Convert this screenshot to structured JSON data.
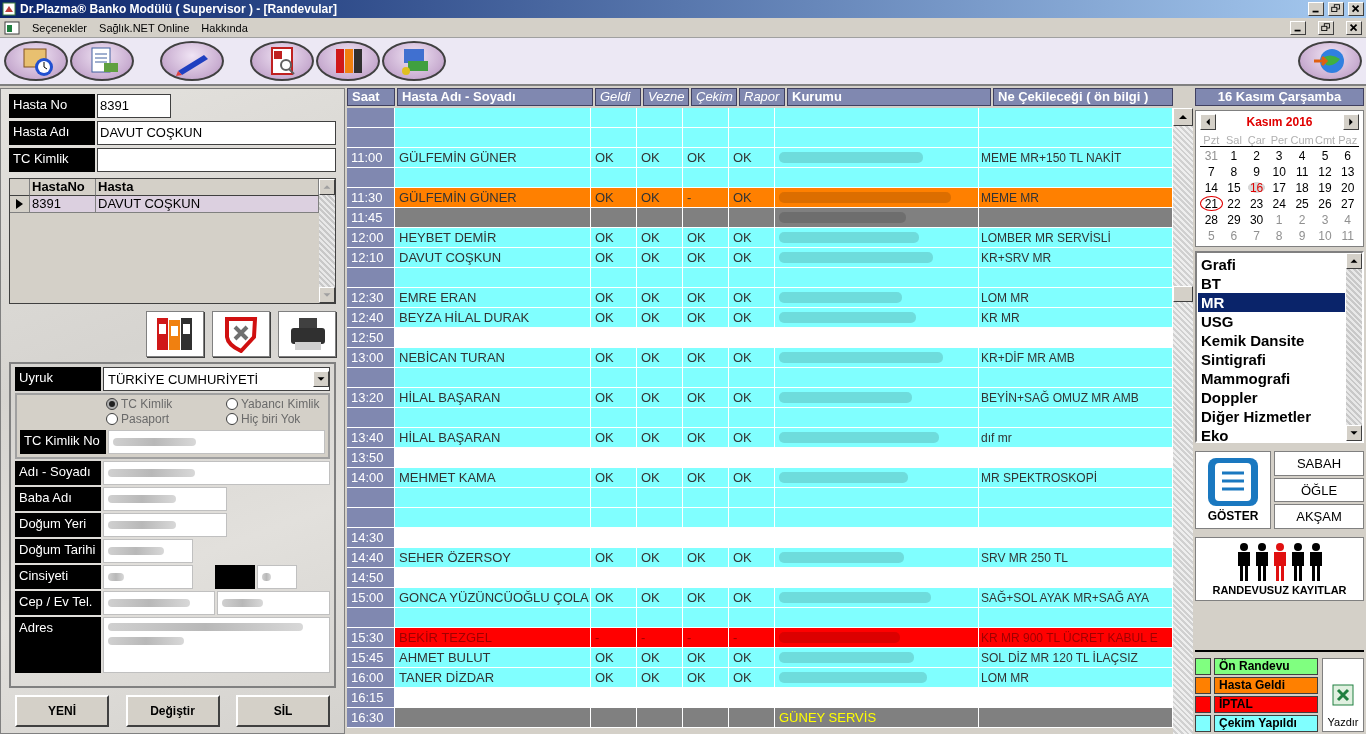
{
  "window": {
    "title": "Dr.Plazma® Banko Modülü ( Supervisor ) - [Randevular]"
  },
  "menu": [
    "Seçenekler",
    "Sağlık.NET Online",
    "Hakkında"
  ],
  "search_fields": [
    {
      "label": "Hasta No",
      "value": "8391",
      "kind": "short"
    },
    {
      "label": "Hasta Adı",
      "value": "DAVUT COŞKUN",
      "kind": "long"
    },
    {
      "label": "TC Kimlik",
      "kind": "long"
    }
  ],
  "patients": {
    "columns": [
      "HastaNo",
      "Hasta"
    ],
    "rows": [
      {
        "cells": [
          "8391",
          "DAVUT COŞKUN"
        ],
        "selected": true
      }
    ]
  },
  "nationality": {
    "label": "Uyruk",
    "value": "TÜRKİYE CUMHURİYETİ"
  },
  "radios": {
    "disabled": true,
    "options": [
      {
        "label": "TC Kimlik",
        "selected": true
      },
      {
        "label": "Yabancı Kimlik",
        "selected": false
      },
      {
        "label": "Pasaport",
        "selected": false
      },
      {
        "label": "Hiç biri Yok",
        "selected": false
      }
    ]
  },
  "form": [
    {
      "label": "TC Kimlik No",
      "kind": "long",
      "redacted": true
    },
    {
      "label": "Adı - Soyadı",
      "kind": "long",
      "redacted": true
    },
    {
      "label": "Baba Adı",
      "kind": "medium",
      "redacted": true
    },
    {
      "label": "Doğum Yeri",
      "kind": "medium",
      "redacted": true
    },
    {
      "label": "Doğum Tarihi",
      "kind": "short",
      "redacted": true
    },
    {
      "label": "Cinsiyeti",
      "kind": "select",
      "redacted": true
    },
    {
      "label": "Cep / Ev Tel.",
      "kind": "phone",
      "redacted": true
    },
    {
      "label": "Adres",
      "kind": "address",
      "redacted": true
    }
  ],
  "actions": [
    "YENİ",
    "Değiştir",
    "SİL"
  ],
  "schedule": {
    "columns": [
      {
        "label": "Saat",
        "italic": false
      },
      {
        "label": "Hasta Adı - Soyadı",
        "italic": false
      },
      {
        "label": "Geldi",
        "italic": true
      },
      {
        "label": "Vezne",
        "italic": true
      },
      {
        "label": "Çekim",
        "italic": true
      },
      {
        "label": "Rapor",
        "italic": true
      },
      {
        "label": "Kurumu",
        "italic": false
      },
      {
        "label": "Ne Çekileceği ( ön bilgi )",
        "italic": false
      }
    ],
    "rows": [
      {
        "color": "#80ffff",
        "kurum_redacted": false
      },
      {
        "color": "#80ffff",
        "kurum_redacted": false
      },
      {
        "time": "11:00",
        "name": "GÜLFEMİN GÜNER",
        "checks": [
          "OK",
          "OK",
          "OK",
          "OK"
        ],
        "kurum_redacted": true,
        "detail": "MEME MR+150 TL NAKİT",
        "color": "#80ffff"
      },
      {
        "color": "#80ffff",
        "kurum_redacted": false
      },
      {
        "time": "11:30",
        "name": "GÜLFEMİN GÜNER",
        "checks": [
          "OK",
          "OK",
          "-",
          "OK"
        ],
        "kurum_redacted": true,
        "detail": "MEME MR",
        "color": "#ff8000"
      },
      {
        "time": "11:45",
        "kurum_redacted": true,
        "color": "#808080"
      },
      {
        "time": "12:00",
        "name": "HEYBET DEMİR",
        "checks": [
          "OK",
          "OK",
          "OK",
          "OK"
        ],
        "kurum_redacted": true,
        "detail": "LOMBER MR SERVİSLİ",
        "color": "#80ffff"
      },
      {
        "time": "12:10",
        "name": "DAVUT COŞKUN",
        "checks": [
          "OK",
          "OK",
          "OK",
          "OK"
        ],
        "kurum_redacted": true,
        "detail": "KR+SRV MR",
        "color": "#80ffff"
      },
      {
        "color": "#80ffff",
        "kurum_redacted": false
      },
      {
        "time": "12:30",
        "name": "EMRE ERAN",
        "checks": [
          "OK",
          "OK",
          "OK",
          "OK"
        ],
        "kurum_redacted": true,
        "detail": "LOM MR",
        "color": "#80ffff"
      },
      {
        "time": "12:40",
        "name": "BEYZA HİLAL DURAK",
        "checks": [
          "OK",
          "OK",
          "OK",
          "OK"
        ],
        "kurum_redacted": true,
        "detail": "KR MR",
        "color": "#80ffff"
      },
      {
        "time": "12:50",
        "color": "#ffffff",
        "kurum_redacted": false
      },
      {
        "time": "13:00",
        "name": "NEBİCAN TURAN",
        "checks": [
          "OK",
          "OK",
          "OK",
          "OK"
        ],
        "kurum_redacted": true,
        "detail": "KR+DİF MR AMB",
        "color": "#80ffff"
      },
      {
        "color": "#80ffff",
        "kurum_redacted": false
      },
      {
        "time": "13:20",
        "name": "HİLAL BAŞARAN",
        "checks": [
          "OK",
          "OK",
          "OK",
          "OK"
        ],
        "kurum_redacted": true,
        "detail": "BEYİN+SAĞ OMUZ MR AMB",
        "color": "#80ffff"
      },
      {
        "color": "#80ffff",
        "kurum_redacted": false
      },
      {
        "time": "13:40",
        "name": "HİLAL BAŞARAN",
        "checks": [
          "OK",
          "OK",
          "OK",
          "OK"
        ],
        "kurum_redacted": true,
        "detail": "dıf mr",
        "color": "#80ffff"
      },
      {
        "time": "13:50",
        "color": "#ffffff",
        "kurum_redacted": false
      },
      {
        "time": "14:00",
        "name": "MEHMET KAMA",
        "checks": [
          "OK",
          "OK",
          "OK",
          "OK"
        ],
        "kurum_redacted": true,
        "detail": "MR SPEKTROSKOPİ",
        "color": "#80ffff"
      },
      {
        "color": "#80ffff",
        "kurum_redacted": false
      },
      {
        "color": "#80ffff",
        "kurum_redacted": false
      },
      {
        "time": "14:30",
        "color": "#ffffff",
        "kurum_redacted": false
      },
      {
        "time": "14:40",
        "name": "SEHER ÖZERSOY",
        "checks": [
          "OK",
          "OK",
          "OK",
          "OK"
        ],
        "kurum_redacted": true,
        "detail": "SRV MR 250 TL",
        "color": "#80ffff"
      },
      {
        "time": "14:50",
        "color": "#ffffff",
        "kurum_redacted": false
      },
      {
        "time": "15:00",
        "name": "GONCA YÜZÜNCÜOĞLU ÇOLA",
        "checks": [
          "OK",
          "OK",
          "OK",
          "OK"
        ],
        "kurum_redacted": true,
        "detail": "SAĞ+SOL AYAK MR+SAĞ AYA",
        "color": "#80ffff"
      },
      {
        "color": "#80ffff",
        "kurum_redacted": false
      },
      {
        "time": "15:30",
        "name": "BEKİR TEZGEL",
        "checks": [
          "-",
          "-",
          "-",
          "-"
        ],
        "kurum_redacted": true,
        "detail": "KR MR 900 TL ÜCRET KABUL E",
        "color": "#ff0000"
      },
      {
        "time": "15:45",
        "name": "AHMET BULUT",
        "checks": [
          "OK",
          "OK",
          "OK",
          "OK"
        ],
        "kurum_redacted": true,
        "detail": "SOL DİZ MR 120 TL İLAÇSIZ",
        "color": "#80ffff"
      },
      {
        "time": "16:00",
        "name": "TANER DİZDAR",
        "checks": [
          "OK",
          "OK",
          "OK",
          "OK"
        ],
        "kurum_redacted": true,
        "detail": "LOM MR",
        "color": "#80ffff"
      },
      {
        "time": "16:15",
        "color": "#ffffff",
        "kurum_redacted": false
      },
      {
        "time": "16:30",
        "kurum": "GÜNEY SERVİS",
        "kurum_redacted": false,
        "color": "#808080"
      }
    ]
  },
  "date_header": "16 Kasım Çarşamba",
  "calendar": {
    "month": "Kasım 2016",
    "weekdays": [
      "Pzt",
      "Sal",
      "Çar",
      "Per",
      "Cum",
      "Cmt",
      "Paz"
    ],
    "weeks": [
      [
        {
          "d": "31",
          "muted": true,
          "today": false,
          "circled": false
        },
        {
          "d": "1",
          "muted": false,
          "today": false,
          "circled": false
        },
        {
          "d": "2",
          "muted": false,
          "today": false,
          "circled": false
        },
        {
          "d": "3",
          "muted": false,
          "today": false,
          "circled": false
        },
        {
          "d": "4",
          "muted": false,
          "today": false,
          "circled": false
        },
        {
          "d": "5",
          "muted": false,
          "today": false,
          "circled": false
        },
        {
          "d": "6",
          "muted": false,
          "today": false,
          "circled": false
        }
      ],
      [
        {
          "d": "7",
          "muted": false,
          "today": false,
          "circled": false
        },
        {
          "d": "8",
          "muted": false,
          "today": false,
          "circled": false
        },
        {
          "d": "9",
          "muted": false,
          "today": false,
          "circled": false
        },
        {
          "d": "10",
          "muted": false,
          "today": false,
          "circled": false
        },
        {
          "d": "11",
          "muted": false,
          "today": false,
          "circled": false
        },
        {
          "d": "12",
          "muted": false,
          "today": false,
          "circled": false
        },
        {
          "d": "13",
          "muted": false,
          "today": false,
          "circled": false
        }
      ],
      [
        {
          "d": "14",
          "muted": false,
          "today": false,
          "circled": false
        },
        {
          "d": "15",
          "muted": false,
          "today": false,
          "circled": false
        },
        {
          "d": "16",
          "muted": false,
          "today": true,
          "circled": false
        },
        {
          "d": "17",
          "muted": false,
          "today": false,
          "circled": false
        },
        {
          "d": "18",
          "muted": false,
          "today": false,
          "circled": false
        },
        {
          "d": "19",
          "muted": false,
          "today": false,
          "circled": false
        },
        {
          "d": "20",
          "muted": false,
          "today": false,
          "circled": false
        }
      ],
      [
        {
          "d": "21",
          "muted": false,
          "today": false,
          "circled": true
        },
        {
          "d": "22",
          "muted": false,
          "today": false,
          "circled": false
        },
        {
          "d": "23",
          "muted": false,
          "today": false,
          "circled": false
        },
        {
          "d": "24",
          "muted": false,
          "today": false,
          "circled": false
        },
        {
          "d": "25",
          "muted": false,
          "today": false,
          "circled": false
        },
        {
          "d": "26",
          "muted": false,
          "today": false,
          "circled": false
        },
        {
          "d": "27",
          "muted": false,
          "today": false,
          "circled": false
        }
      ],
      [
        {
          "d": "28",
          "muted": false,
          "today": false,
          "circled": false
        },
        {
          "d": "29",
          "muted": false,
          "today": false,
          "circled": false
        },
        {
          "d": "30",
          "muted": false,
          "today": false,
          "circled": false
        },
        {
          "d": "1",
          "muted": true,
          "today": false,
          "circled": false
        },
        {
          "d": "2",
          "muted": true,
          "today": false,
          "circled": false
        },
        {
          "d": "3",
          "muted": true,
          "today": false,
          "circled": false
        },
        {
          "d": "4",
          "muted": true,
          "today": false,
          "circled": false
        }
      ],
      [
        {
          "d": "5",
          "muted": true,
          "today": false,
          "circled": false
        },
        {
          "d": "6",
          "muted": true,
          "today": false,
          "circled": false
        },
        {
          "d": "7",
          "muted": true,
          "today": false,
          "circled": false
        },
        {
          "d": "8",
          "muted": true,
          "today": false,
          "circled": false
        },
        {
          "d": "9",
          "muted": true,
          "today": false,
          "circled": false
        },
        {
          "d": "10",
          "muted": true,
          "today": false,
          "circled": false
        },
        {
          "d": "11",
          "muted": true,
          "today": false,
          "circled": false
        }
      ]
    ]
  },
  "modalities": [
    {
      "label": "Grafi",
      "selected": false
    },
    {
      "label": "BT",
      "selected": false
    },
    {
      "label": "MR",
      "selected": true
    },
    {
      "label": "USG",
      "selected": false
    },
    {
      "label": "Kemik Dansite",
      "selected": false
    },
    {
      "label": "Sintigrafi",
      "selected": false
    },
    {
      "label": "Mammografi",
      "selected": false
    },
    {
      "label": "Doppler",
      "selected": false
    },
    {
      "label": "Diğer Hizmetler",
      "selected": false
    },
    {
      "label": "Eko",
      "selected": false
    }
  ],
  "show_button": "GÖSTER",
  "shifts": [
    "SABAH",
    "ÖĞLE",
    "AKŞAM"
  ],
  "walkin_button": "RANDEVUSUZ KAYITLAR",
  "legend": [
    {
      "label": "Ön Randevu",
      "color": "#80ff80"
    },
    {
      "label": "Hasta Geldi",
      "color": "#ff8000"
    },
    {
      "label": "İPTAL",
      "color": "#ff0000"
    },
    {
      "label": "Çekim Yapıldı",
      "color": "#80ffff"
    }
  ],
  "print_button": "Yazdır"
}
